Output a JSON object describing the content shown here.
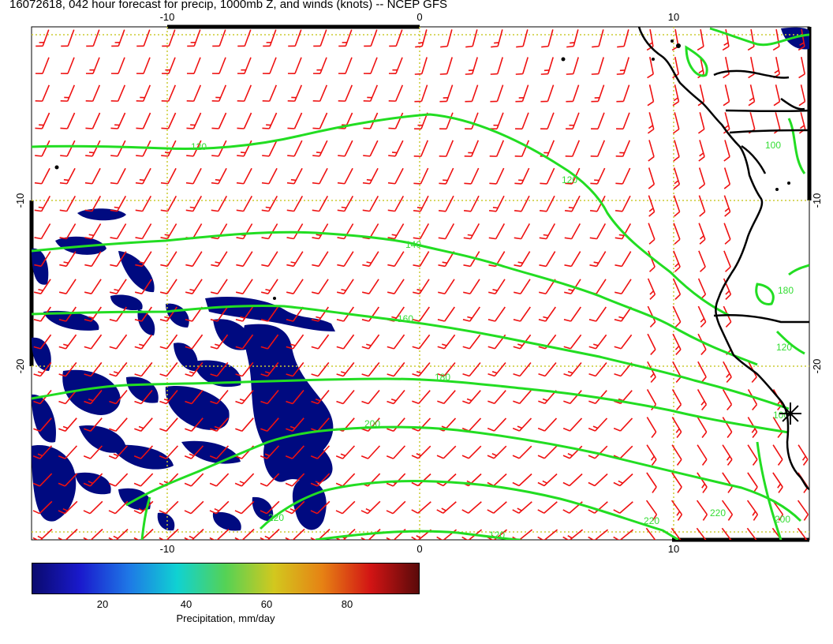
{
  "title": "16072618, 042 hour forecast for precip, 1000mb Z, and winds (knots) -- NCEP GFS",
  "axes": {
    "lon_ticks_top": [
      "-10",
      "0",
      "10"
    ],
    "lon_ticks_bottom": [
      "-10",
      "0",
      "10"
    ],
    "lat_ticks_left": [
      "-10",
      "-20"
    ],
    "lat_ticks_right": [
      "-10",
      "-20"
    ],
    "lon_range": [
      -15.5,
      15.5
    ],
    "lat_range": [
      -30,
      -10
    ]
  },
  "contours": {
    "color": "#22dd22",
    "labels": [
      "120",
      "120",
      "140",
      "160",
      "180",
      "200",
      "220",
      "220",
      "200",
      "180",
      "100",
      "120",
      "100",
      "120",
      "220"
    ]
  },
  "colorbar": {
    "ticks": [
      "20",
      "40",
      "60",
      "80"
    ],
    "title": "Precipitation, mm/day",
    "colors": [
      "#0a0a6e",
      "#1a1acd",
      "#1e78e6",
      "#10d2d2",
      "#55d255",
      "#d2c81e",
      "#e68214",
      "#d21414",
      "#5a0a0a"
    ]
  },
  "wind_barb_color": "#ee1111",
  "precip_color": "#000a80",
  "coast_color": "#000000",
  "grid_color": "#cccc33"
}
